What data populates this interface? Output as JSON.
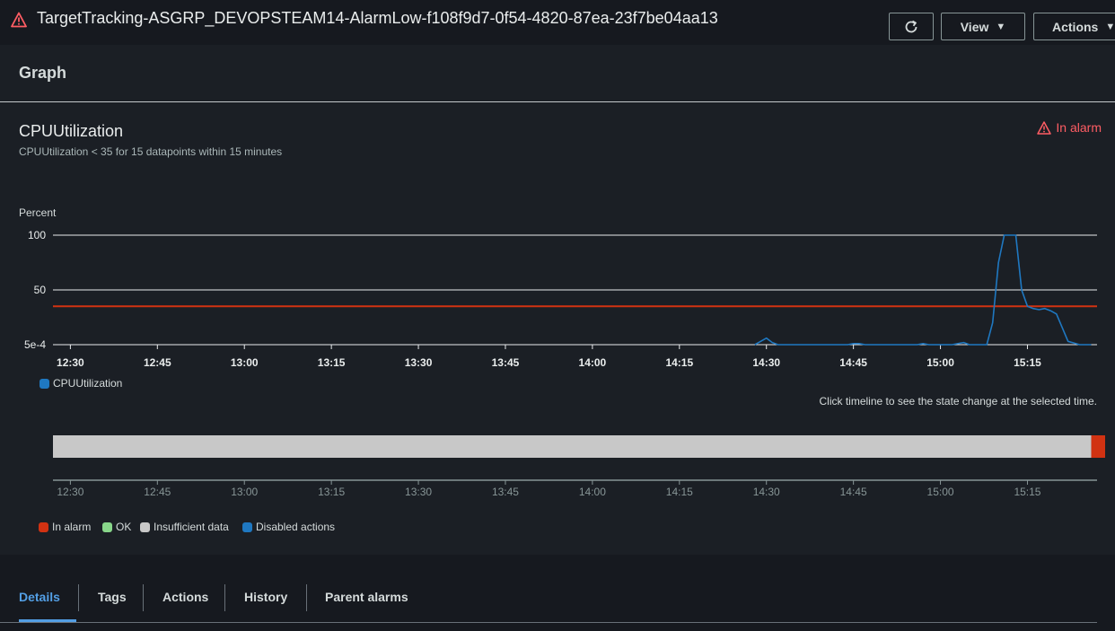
{
  "header": {
    "alarm_name": "TargetTracking-ASGRP_DEVOPSTEAM14-AlarmLow-f108f9d7-0f54-4820-87ea-23f7be04aa13",
    "view_label": "View",
    "actions_label": "Actions",
    "icons": {
      "alarm": "warning-triangle-icon",
      "refresh": "refresh-icon",
      "dropdown": "caret-down-icon"
    }
  },
  "graph": {
    "heading": "Graph",
    "metric_name": "CPUUtilization",
    "condition": "CPUUtilization < 35 for 15 datapoints within 15 minutes",
    "state": "In alarm",
    "hint": "Click timeline to see the state change at the selected time."
  },
  "colors": {
    "series": "#1f78c1",
    "threshold": "#d13212",
    "alarm": "#ff5d64",
    "ok": "#88d68a",
    "insufficient": "#c8c8c8",
    "disabled": "#1f78c1",
    "active_tab": "#539fe5"
  },
  "chart_data": {
    "type": "line",
    "ylabel": "Percent",
    "y_ticks": [
      "100",
      "50",
      "5e-4"
    ],
    "y_tick_values": [
      100,
      50,
      0
    ],
    "ylim": [
      0,
      100
    ],
    "x_ticks": [
      "12:30",
      "12:45",
      "13:00",
      "13:15",
      "13:30",
      "13:45",
      "14:00",
      "14:15",
      "14:30",
      "14:45",
      "15:00",
      "15:15"
    ],
    "x_tick_minutes": [
      0,
      15,
      30,
      45,
      60,
      75,
      90,
      105,
      120,
      135,
      150,
      165
    ],
    "x_range_minutes": [
      -3,
      177
    ],
    "threshold": 35,
    "grid": true,
    "legend_position": "bottom-left",
    "series": [
      {
        "name": "CPUUtilization",
        "x_minutes": [
          118,
          120,
          121,
          122,
          124,
          126,
          128,
          130,
          132,
          134,
          135,
          136,
          137,
          138,
          140,
          142,
          144,
          146,
          147,
          148,
          150,
          152,
          154,
          155,
          156,
          157,
          158,
          159,
          160,
          161,
          162,
          163,
          164,
          165,
          166,
          167,
          168,
          169,
          170,
          172,
          174,
          176
        ],
        "values": [
          0,
          6,
          2,
          0,
          0,
          0,
          0,
          0,
          0,
          0,
          1,
          1,
          0,
          0,
          0,
          0,
          0,
          0,
          1,
          0,
          0,
          0,
          2,
          0,
          0,
          0,
          0,
          20,
          75,
          100,
          100,
          100,
          50,
          35,
          33,
          32,
          33,
          31,
          28,
          3,
          0,
          0
        ]
      }
    ]
  },
  "timeline": {
    "x_ticks": [
      "12:30",
      "12:45",
      "13:00",
      "13:15",
      "13:30",
      "13:45",
      "14:00",
      "14:15",
      "14:30",
      "14:45",
      "15:00",
      "15:15"
    ],
    "segments": [
      {
        "state": "Insufficient data",
        "start_minute": -3,
        "end_minute": 176
      },
      {
        "state": "In alarm",
        "start_minute": 176,
        "end_minute": 177
      }
    ],
    "legend": [
      {
        "label": "In alarm",
        "color": "#d13212"
      },
      {
        "label": "OK",
        "color": "#88d68a"
      },
      {
        "label": "Insufficient data",
        "color": "#c8c8c8"
      },
      {
        "label": "Disabled actions",
        "color": "#1f78c1"
      }
    ]
  },
  "tabs": [
    {
      "label": "Details",
      "active": true
    },
    {
      "label": "Tags",
      "active": false
    },
    {
      "label": "Actions",
      "active": false
    },
    {
      "label": "History",
      "active": false
    },
    {
      "label": "Parent alarms",
      "active": false
    }
  ]
}
